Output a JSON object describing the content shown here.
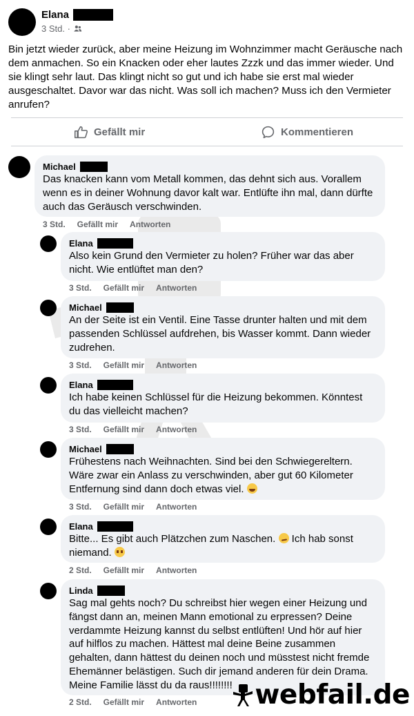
{
  "post": {
    "author": "Elana",
    "time": "3 Std. ·",
    "text": "Bin jetzt wieder zurück, aber meine Heizung im Wohnzimmer macht Geräusche nach dem anmachen. So ein Knacken oder eher lautes Zzzk und das immer wieder. Und sie klingt sehr laut. Das klingt nicht so gut und ich habe sie erst mal wieder ausgeschaltet. Davor war das nicht. Was soll ich machen? Muss ich den Vermieter anrufen?"
  },
  "actions": {
    "like": "Gefällt mir",
    "comment": "Kommentieren"
  },
  "comments": [
    {
      "name": "Michael",
      "text": "Das knacken kann vom Metall kommen, das dehnt sich aus. Vorallem wenn es in deiner Wohnung davor kalt war. Entlüfte ihn mal, dann dürfte auch das Geräusch verschwinden.",
      "time": "3 Std.",
      "like": "Gefällt mir",
      "reply": "Antworten"
    },
    {
      "name": "Elana",
      "text": "Also kein Grund den Vermieter zu holen? Früher war das aber nicht. Wie entlüftet man den?",
      "time": "3 Std.",
      "like": "Gefällt mir",
      "reply": "Antworten"
    },
    {
      "name": "Michael",
      "text": "An der Seite ist ein Ventil. Eine Tasse drunter halten und mit dem passenden Schlüssel aufdrehen, bis Wasser kommt. Dann wieder zudrehen.",
      "time": "3 Std.",
      "like": "Gefällt mir",
      "reply": "Antworten"
    },
    {
      "name": "Elana",
      "text": "Ich habe keinen Schlüssel für die Heizung bekommen. Könntest du das vielleicht machen?",
      "time": "3 Std.",
      "like": "Gefällt mir",
      "reply": "Antworten"
    },
    {
      "name": "Michael",
      "text": "Frühestens nach Weihnachten. Sind bei den Schwiegereltern. Wäre zwar ein Anlass zu verschwinden, aber gut 60 Kilometer Entfernung sind dann doch etwas viel.",
      "time": "3 Std.",
      "like": "Gefällt mir",
      "reply": "Antworten"
    },
    {
      "name": "Elana",
      "text": "Bitte... Es gibt auch Plätzchen zum Naschen.",
      "text2": "Ich hab sonst niemand.",
      "time": "2 Std.",
      "like": "Gefällt mir",
      "reply": "Antworten"
    },
    {
      "name": "Linda",
      "text": "Sag mal gehts noch? Du schreibst hier wegen einer Heizung und fängst dann an, meinen Mann emotional zu erpressen? Deine verdammte Heizung kannst du selbst entlüften! Und hör auf hier auf hilflos zu machen. Hättest mal deine Beine zusammen gehalten, dann hättest du deinen noch und müsstest nicht fremde Ehemänner belästigen. Such dir jemand anderen für dein Drama. Meine Familie lässt du da raus!!!!!!!!",
      "time": "2 Std.",
      "like": "Gefällt mir",
      "reply": "Antworten"
    }
  ],
  "watermark": "webfail.de",
  "icons": {
    "like": "thumbs-up-icon",
    "comment": "speech-bubble-icon",
    "audience": "friends-icon",
    "emoji_grin": "grinning-sweat-emoji",
    "emoji_smirk": "smirk-emoji",
    "emoji_plead": "pleading-emoji"
  }
}
